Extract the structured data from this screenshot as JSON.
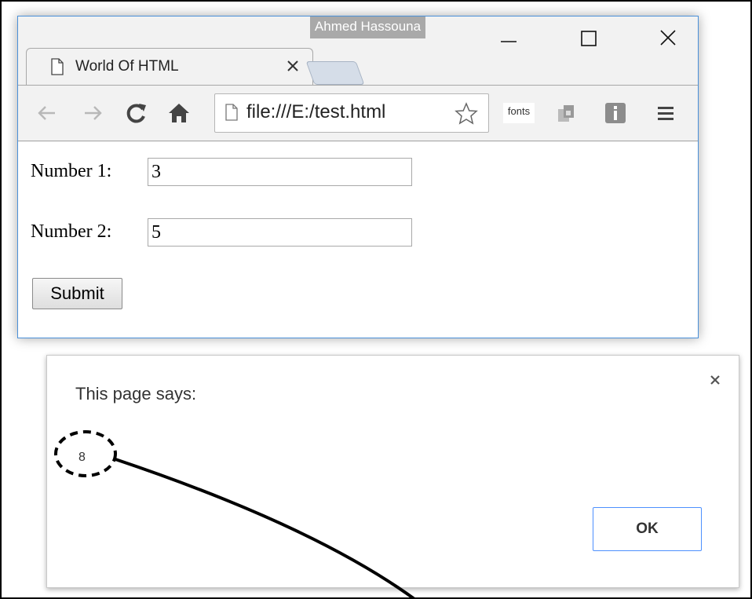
{
  "window": {
    "profile_name": "Ahmed Hassouna",
    "tab_title": "World Of HTML",
    "url": "file:///E:/test.html",
    "extension_label": "fonts"
  },
  "form": {
    "number1_label": "Number 1:",
    "number1_value": "3",
    "number2_label": "Number 2:",
    "number2_value": "5",
    "submit_label": "Submit"
  },
  "dialog": {
    "title": "This page says:",
    "message": "8",
    "ok_label": "OK"
  },
  "colors": {
    "window_border": "#4a90d9",
    "ok_border": "#4d90fe",
    "profile_badge": "#a9a9a9"
  },
  "icons": [
    "page-icon",
    "close-icon",
    "minimize-icon",
    "maximize-icon",
    "back-arrow-icon",
    "forward-arrow-icon",
    "reload-icon",
    "home-icon",
    "star-icon",
    "extension-icon",
    "info-icon",
    "menu-icon"
  ]
}
